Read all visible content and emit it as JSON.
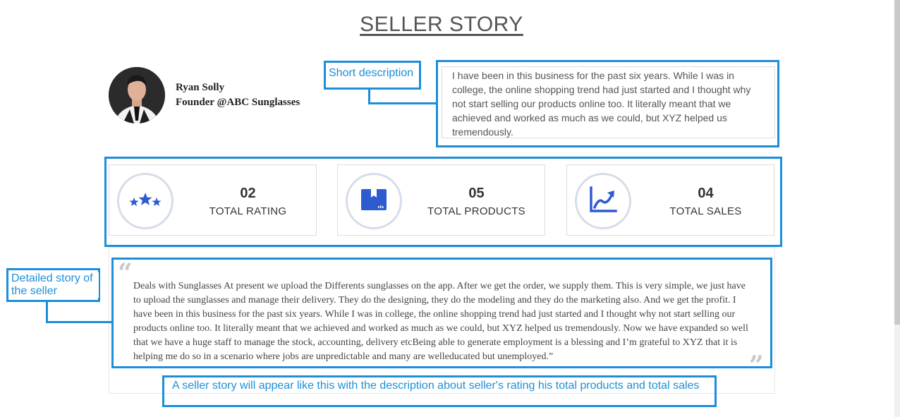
{
  "page": {
    "title": "SELLER STORY"
  },
  "seller": {
    "name": "Ryan Solly",
    "role": "Founder @ABC Sunglasses",
    "short_description": "I have been in this business for the past six years. While I was in college, the online shopping trend had just started and I thought why not start selling our products online too. It literally meant that we achieved and worked as much as we could, but XYZ helped us tremendously."
  },
  "stats": [
    {
      "value": "02",
      "label": "TOTAL RATING",
      "icon": "stars-icon"
    },
    {
      "value": "05",
      "label": "TOTAL PRODUCTS",
      "icon": "product-box-icon"
    },
    {
      "value": "04",
      "label": "TOTAL SALES",
      "icon": "sales-chart-icon"
    }
  ],
  "story": {
    "text": "Deals with Sunglasses At present we upload the Differents sunglasses on the app. After we get the order, we supply them. This is very simple, we just have to upload the sunglasses and manage their delivery. They do the designing, they do the modeling and they do the marketing also. And we get the profit. I have been in this business for the past six years. While I was in college, the online shopping trend had just started and I thought why not start selling our products online too. It literally meant that we achieved and worked as much as we could, but XYZ helped us tremendously. Now we have expanded so well that we have a huge staff to manage the stock, accounting, delivery etcBeing able to generate employment is a blessing and I’m grateful to XYZ that it is helping me do so in a scenario where jobs are unpredictable and many are welleducated but unemployed.”"
  },
  "annotations": {
    "short_description": "Short description",
    "detailed_story": "Detailed story of the seller",
    "caption": "A seller story will appear like this with the description about seller's rating his total products and total sales"
  },
  "colors": {
    "annotation": "#1c8fd8",
    "icon_blue": "#2f5bd1",
    "circle_border": "#d6dde8"
  }
}
